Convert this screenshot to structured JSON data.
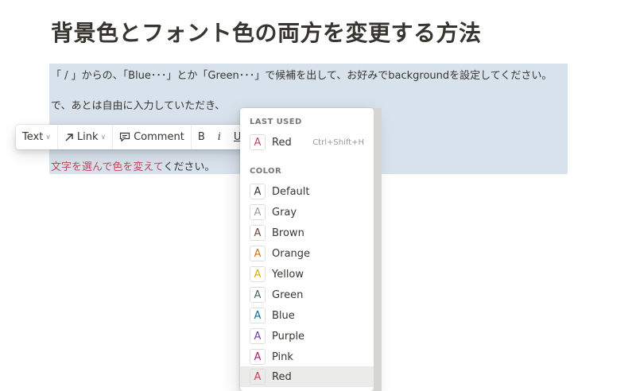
{
  "page": {
    "title": "背景色とフォント色の両方を変更する方法",
    "paragraph1": "「 / 」からの、「Blue･･･」とか「Green･･･」で候補を出して、お好みでbackgroundを設定してください。",
    "paragraph2": "で、あとは自由に入力していただき、",
    "paragraph3_red": "文字を選んで色を変えて",
    "paragraph3_rest": "ください。"
  },
  "toolbar": {
    "text_label": "Text",
    "link_label": "Link",
    "comment_label": "Comment",
    "bold_label": "B",
    "italic_label": "i",
    "underline_label": "U",
    "icons": [
      "chevron-down-icon",
      "arrow-up-right-icon",
      "comment-bubble-icon"
    ]
  },
  "menu": {
    "last_used_label": "LAST USED",
    "last_used": {
      "glyph": "A",
      "label": "Red",
      "shortcut": "Ctrl+Shift+H",
      "color": "#c2455a"
    },
    "color_label": "COLOR",
    "colors": [
      {
        "glyph": "A",
        "label": "Default",
        "color": "#37352f"
      },
      {
        "glyph": "A",
        "label": "Gray",
        "color": "#9b9a97"
      },
      {
        "glyph": "A",
        "label": "Brown",
        "color": "#64473a"
      },
      {
        "glyph": "A",
        "label": "Orange",
        "color": "#d9730d"
      },
      {
        "glyph": "A",
        "label": "Yellow",
        "color": "#dfab01"
      },
      {
        "glyph": "A",
        "label": "Green",
        "color": "#4d6461"
      },
      {
        "glyph": "A",
        "label": "Blue",
        "color": "#0b6e99"
      },
      {
        "glyph": "A",
        "label": "Purple",
        "color": "#6940a5"
      },
      {
        "glyph": "A",
        "label": "Pink",
        "color": "#ad1a72"
      },
      {
        "glyph": "A",
        "label": "Red",
        "color": "#c2455a"
      }
    ],
    "hovered_item": "Red"
  },
  "colors": {
    "selection_bg": "#d8e2ec",
    "text": "#37352f",
    "accent_red": "#c2455a"
  }
}
